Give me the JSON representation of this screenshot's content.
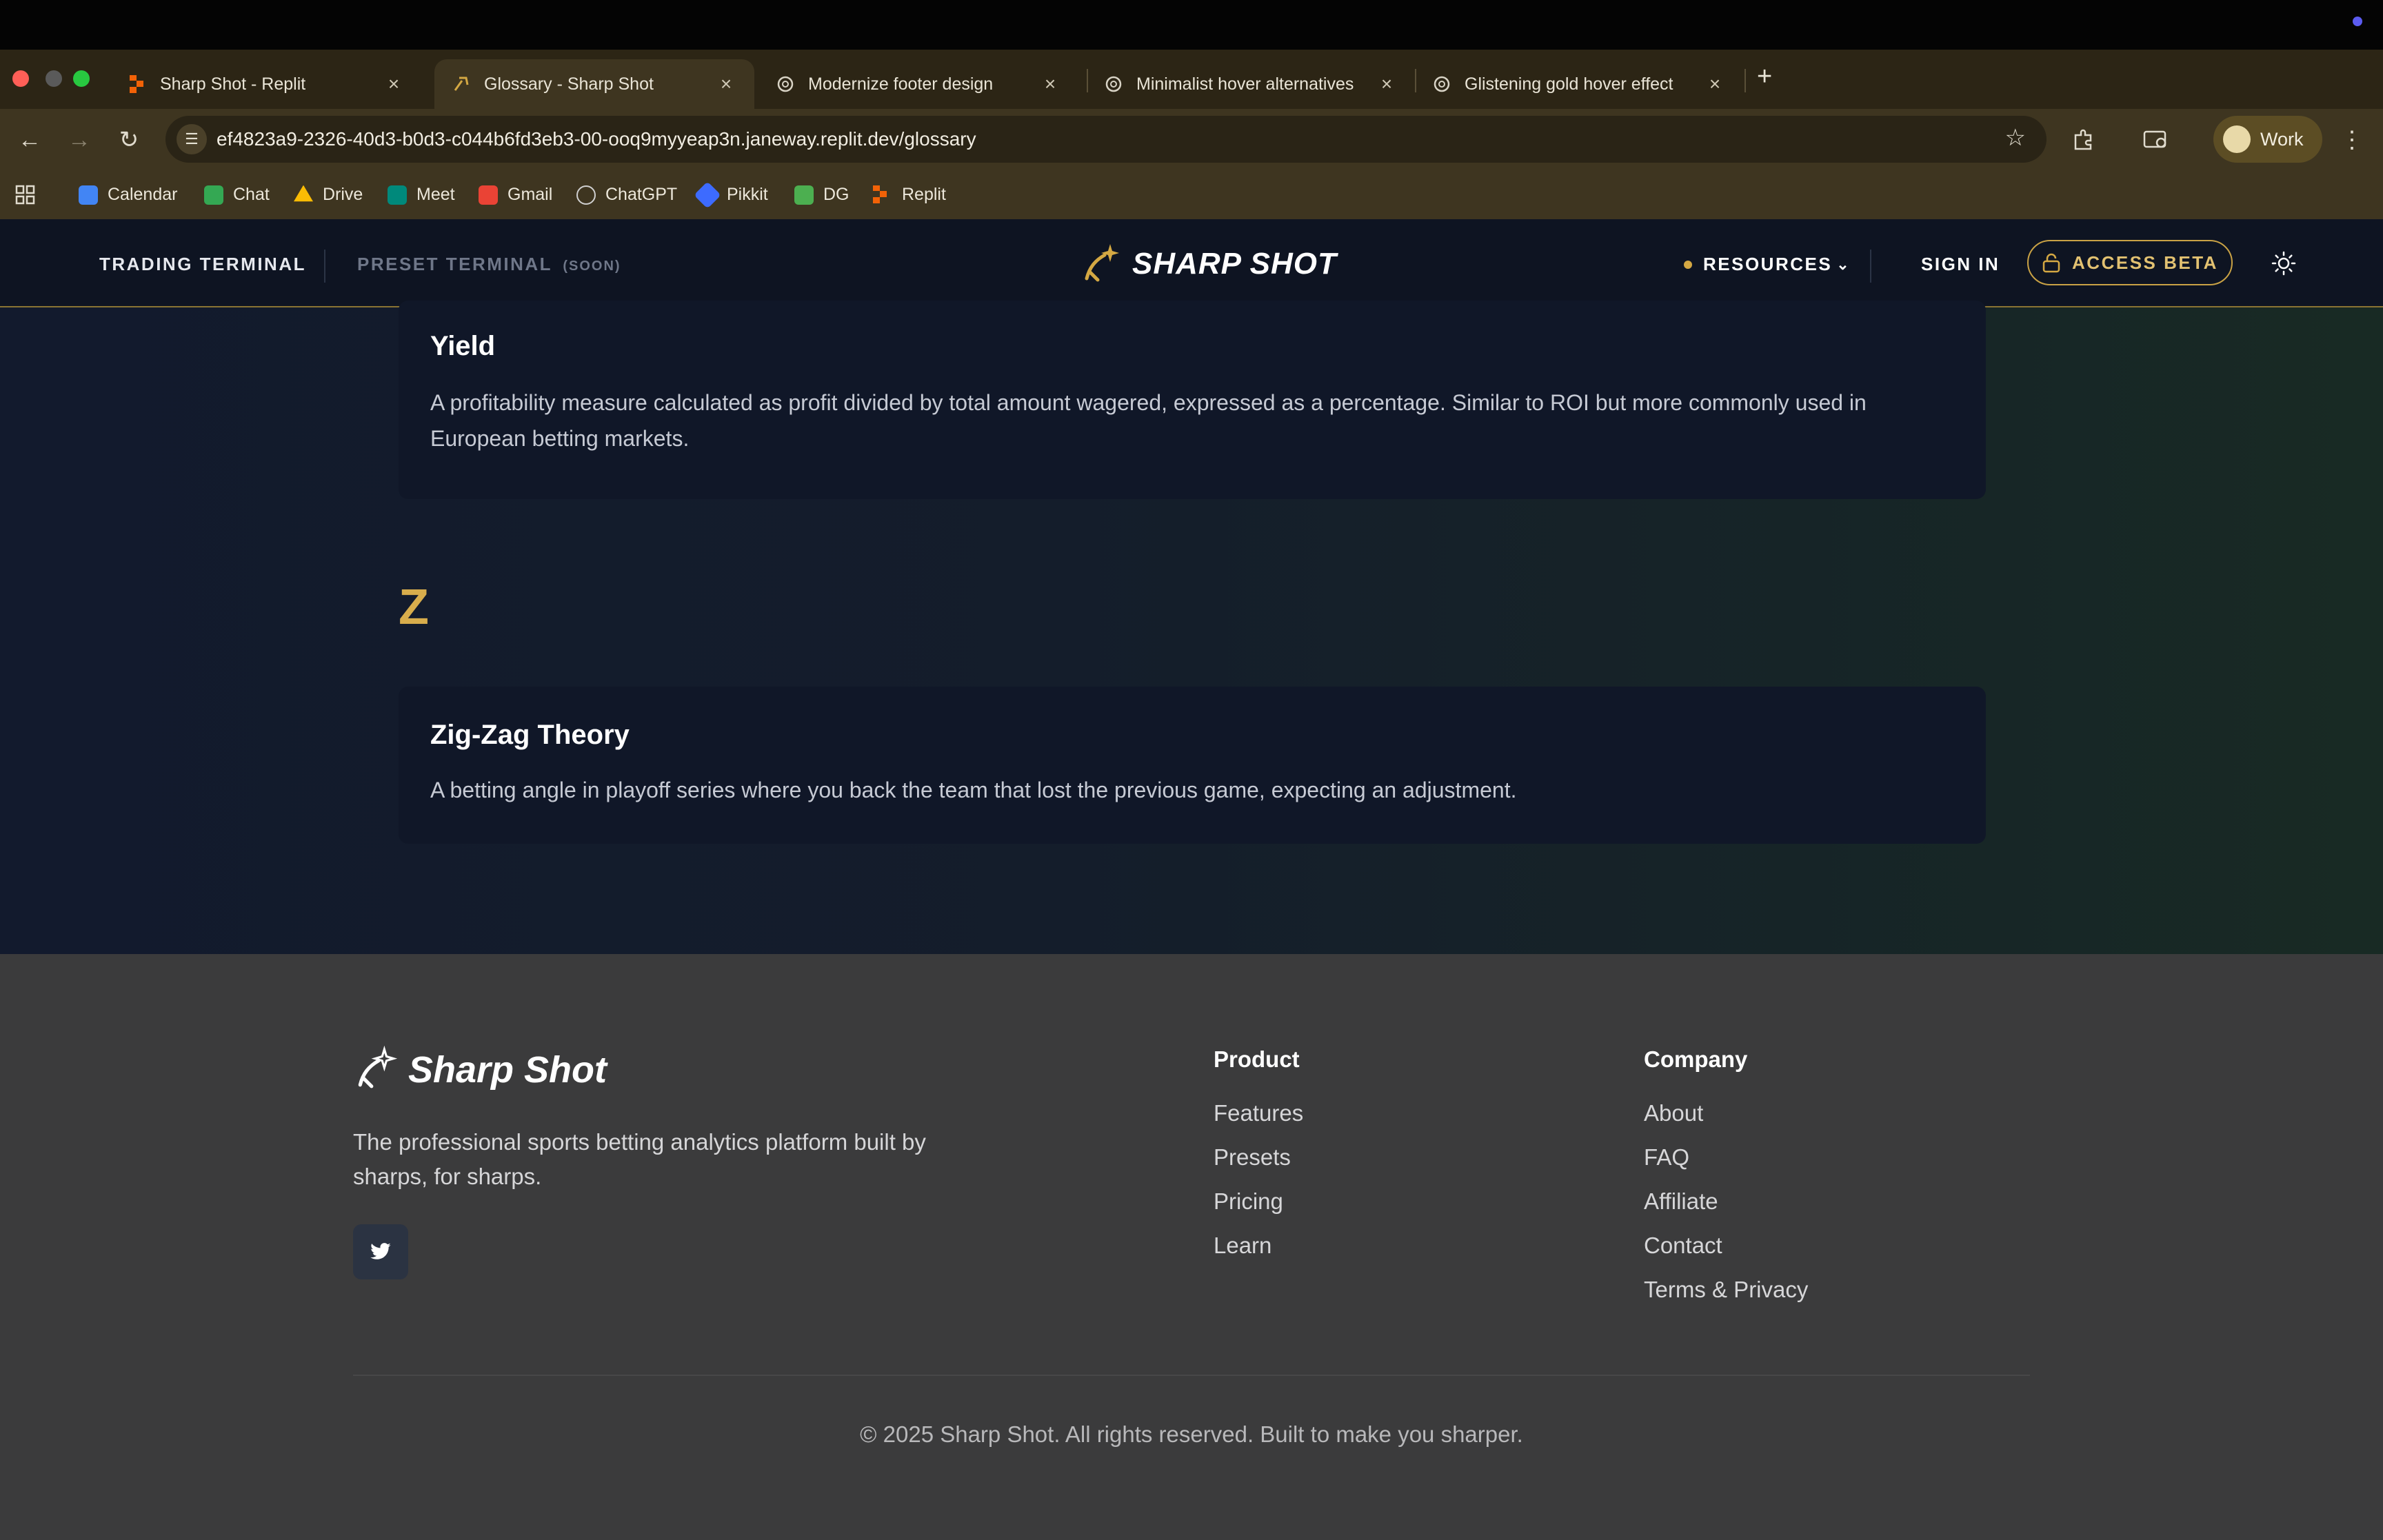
{
  "browser": {
    "tabs": [
      {
        "label": "Sharp Shot - Replit",
        "close": "×",
        "icon": "replit-icon"
      },
      {
        "label": "Glossary - Sharp Shot",
        "close": "×",
        "icon": "sharpshot-favicon"
      },
      {
        "label": "Modernize footer design",
        "close": "×",
        "icon": "chatgpt-icon"
      },
      {
        "label": "Minimalist hover alternatives",
        "close": "×",
        "icon": "chatgpt-icon"
      },
      {
        "label": "Glistening gold hover effect",
        "close": "×",
        "icon": "chatgpt-icon"
      }
    ],
    "new_tab": "+",
    "url": "ef4823a9-2326-40d3-b0d3-c044b6fd3eb3-00-ooq9myyeap3n.janeway.replit.dev/glossary",
    "profile": "Work",
    "bookmarks": [
      {
        "label": "Calendar",
        "icon": "calendar-icon",
        "color": "#4285f4"
      },
      {
        "label": "Chat",
        "icon": "chat-icon",
        "color": "#34a853"
      },
      {
        "label": "Drive",
        "icon": "drive-icon",
        "color": "#fbbc04"
      },
      {
        "label": "Meet",
        "icon": "meet-icon",
        "color": "#00897b"
      },
      {
        "label": "Gmail",
        "icon": "gmail-icon",
        "color": "#ea4335"
      },
      {
        "label": "ChatGPT",
        "icon": "chatgpt-icon",
        "color": "#d0d0d0"
      },
      {
        "label": "Pikkit",
        "icon": "pikkit-icon",
        "color": "#3d6bff"
      },
      {
        "label": "DG",
        "icon": "dg-icon",
        "color": "#4caf50"
      },
      {
        "label": "Replit",
        "icon": "replit-icon",
        "color": "#f26207"
      }
    ]
  },
  "header": {
    "nav_left": [
      "TRADING TERMINAL",
      "PRESET TERMINAL"
    ],
    "soon_badge": "(SOON)",
    "logo_text": "SHARP SHOT",
    "resources": "RESOURCES",
    "sign_in": "SIGN IN",
    "access_beta": "ACCESS BETA",
    "accent": "#d4a843"
  },
  "glossary": {
    "entries_before": [
      {
        "term": "Yield",
        "definition": "A profitability measure calculated as profit divided by total amount wagered, expressed as a percentage. Similar to ROI but more commonly used in European betting markets."
      }
    ],
    "section_letter": "Z",
    "entries": [
      {
        "term": "Zig-Zag Theory",
        "definition": "A betting angle in playoff series where you back the team that lost the previous game, expecting an adjustment."
      }
    ]
  },
  "footer": {
    "logo_text": "Sharp Shot",
    "tagline": "The professional sports betting analytics platform built by sharps, for sharps.",
    "product_title": "Product",
    "product_links": [
      "Features",
      "Presets",
      "Pricing",
      "Learn"
    ],
    "company_title": "Company",
    "company_links": [
      "About",
      "FAQ",
      "Affiliate",
      "Contact",
      "Terms & Privacy"
    ],
    "copyright": "© 2025 Sharp Shot. All rights reserved. Built to make you sharper."
  }
}
